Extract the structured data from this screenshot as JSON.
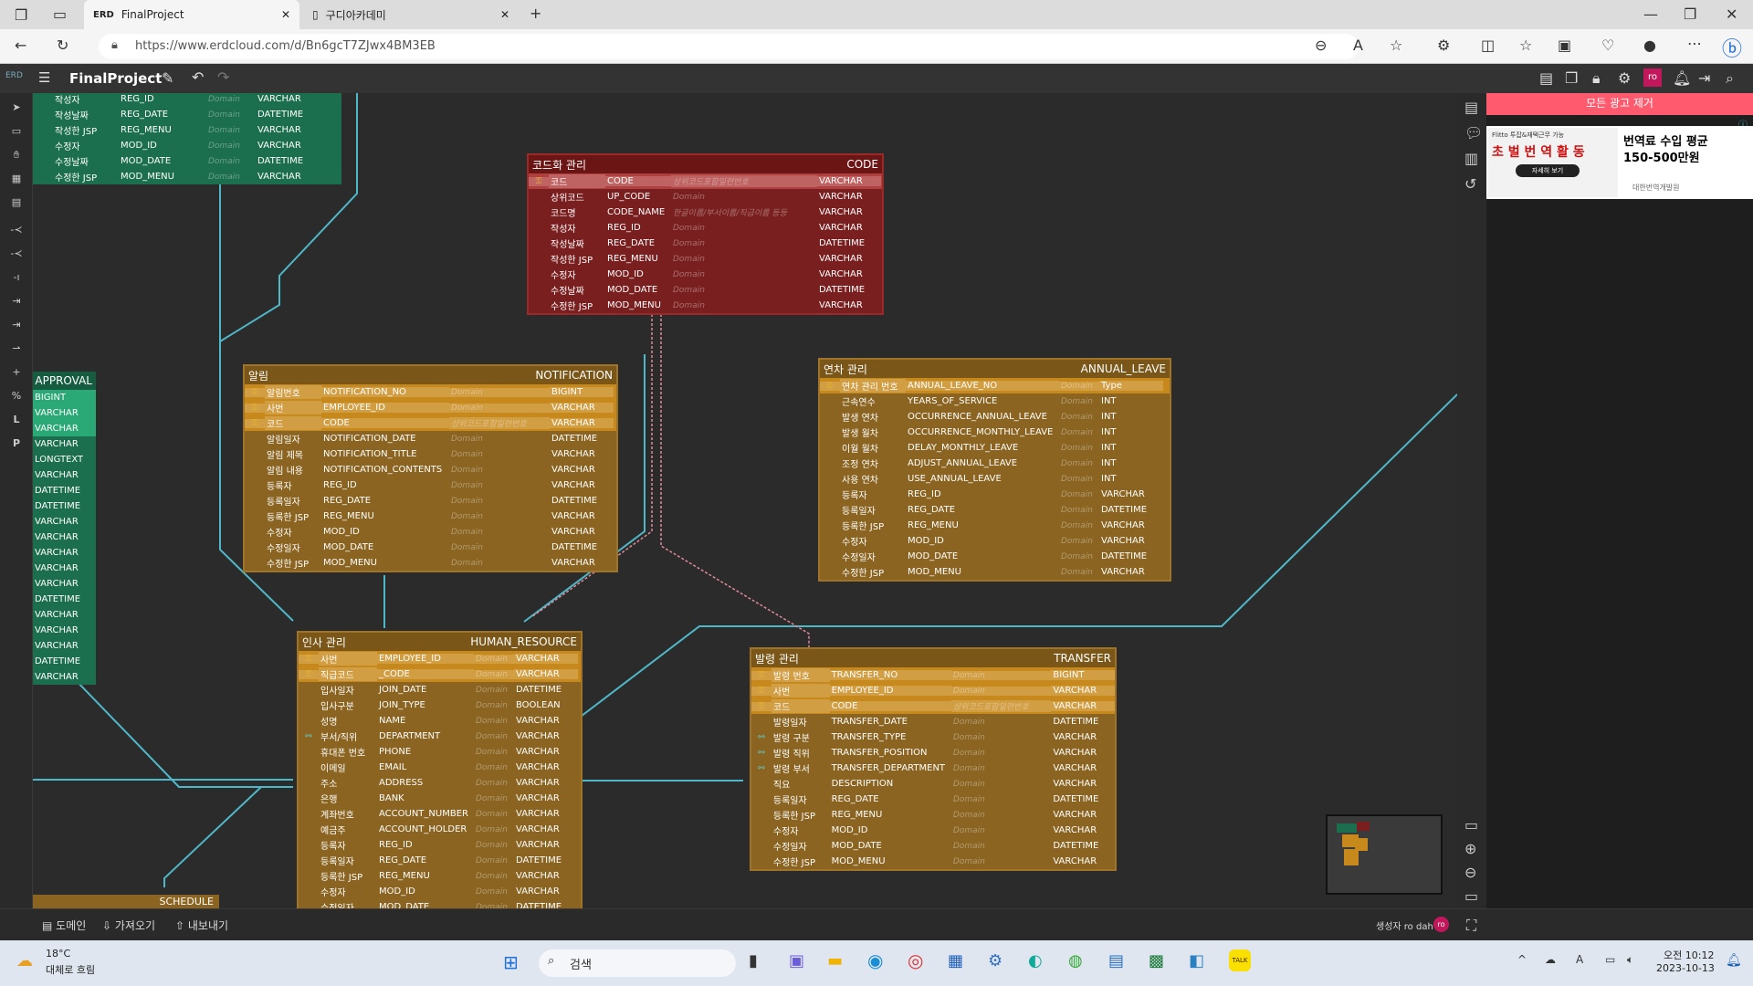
{
  "browser": {
    "tab1": "FinalProject",
    "tab2": "구디아카데미",
    "url": "https://www.erdcloud.com/d/Bn6gcT7ZJwx4BM3EB"
  },
  "app": {
    "title": "FinalProject",
    "avatar": "ro"
  },
  "ad": {
    "remove": "모든 광고 제거",
    "headline1": "번역료 수입 평균",
    "headline2": "150-500만원",
    "brand": "Flitto 투잡&재택근무 가능",
    "big": "초 벌 번 역 활 동",
    "btn": "자세히 보기",
    "sponsor": "대한번역개발원",
    "ad_mark": "ⓘ"
  },
  "bottom": {
    "domain": "도메인",
    "import": "가져오기",
    "export": "내보내기",
    "creator": "생성자 ro dah",
    "avatar": "ro"
  },
  "taskbar": {
    "temp": "18°C",
    "weather": "대체로 흐림",
    "search": "검색",
    "time": "오전 10:12",
    "date": "2023-10-13"
  },
  "tables": {
    "top_partial": {
      "rows": [
        [
          "작성자",
          "REG_ID",
          "Domain",
          "VARCHAR"
        ],
        [
          "작성날짜",
          "REG_DATE",
          "Domain",
          "DATETIME"
        ],
        [
          "작성한 JSP",
          "REG_MENU",
          "Domain",
          "VARCHAR"
        ],
        [
          "수정자",
          "MOD_ID",
          "Domain",
          "VARCHAR"
        ],
        [
          "수정날짜",
          "MOD_DATE",
          "Domain",
          "DATETIME"
        ],
        [
          "수정한 JSP",
          "MOD_MENU",
          "Domain",
          "VARCHAR"
        ]
      ]
    },
    "code": {
      "kname": "코드화 관리",
      "ename": "CODE",
      "rows": [
        [
          "코드",
          "CODE",
          "상위코드포함일련번호",
          "VARCHAR"
        ],
        [
          "상위코드",
          "UP_CODE",
          "Domain",
          "VARCHAR"
        ],
        [
          "코드명",
          "CODE_NAME",
          "한글이름/부서이름/직급이름 등등",
          "VARCHAR"
        ],
        [
          "작성자",
          "REG_ID",
          "Domain",
          "VARCHAR"
        ],
        [
          "작성날짜",
          "REG_DATE",
          "Domain",
          "DATETIME"
        ],
        [
          "작성한 JSP",
          "REG_MENU",
          "Domain",
          "VARCHAR"
        ],
        [
          "수정자",
          "MOD_ID",
          "Domain",
          "VARCHAR"
        ],
        [
          "수정날짜",
          "MOD_DATE",
          "Domain",
          "DATETIME"
        ],
        [
          "수정한 JSP",
          "MOD_MENU",
          "Domain",
          "VARCHAR"
        ]
      ]
    },
    "approval": {
      "ename": "APPROVAL",
      "rows": [
        "BIGINT",
        "VARCHAR",
        "VARCHAR",
        "VARCHAR",
        "LONGTEXT",
        "VARCHAR",
        "DATETIME",
        "DATETIME",
        "VARCHAR",
        "VARCHAR",
        "VARCHAR",
        "VARCHAR",
        "VARCHAR",
        "DATETIME",
        "VARCHAR",
        "VARCHAR",
        "VARCHAR",
        "DATETIME",
        "VARCHAR"
      ]
    },
    "notification": {
      "kname": "알림",
      "ename": "NOTIFICATION",
      "rows": [
        [
          "알림번호",
          "NOTIFICATION_NO",
          "Domain",
          "BIGINT"
        ],
        [
          "사번",
          "EMPLOYEE_ID",
          "Domain",
          "VARCHAR"
        ],
        [
          "코드",
          "CODE",
          "상위코드포함일련번호",
          "VARCHAR"
        ],
        [
          "알림일자",
          "NOTIFICATION_DATE",
          "Domain",
          "DATETIME"
        ],
        [
          "알림 제목",
          "NOTIFICATION_TITLE",
          "Domain",
          "VARCHAR"
        ],
        [
          "알림 내용",
          "NOTIFICATION_CONTENTS",
          "Domain",
          "VARCHAR"
        ],
        [
          "등록자",
          "REG_ID",
          "Domain",
          "VARCHAR"
        ],
        [
          "등록일자",
          "REG_DATE",
          "Domain",
          "DATETIME"
        ],
        [
          "등록한 JSP",
          "REG_MENU",
          "Domain",
          "VARCHAR"
        ],
        [
          "수정자",
          "MOD_ID",
          "Domain",
          "VARCHAR"
        ],
        [
          "수정일자",
          "MOD_DATE",
          "Domain",
          "DATETIME"
        ],
        [
          "수정한 JSP",
          "MOD_MENU",
          "Domain",
          "VARCHAR"
        ]
      ]
    },
    "annual": {
      "kname": "연차 관리",
      "ename": "ANNUAL_LEAVE",
      "rows": [
        [
          "연차 관리 번호",
          "ANNUAL_LEAVE_NO",
          "Domain",
          "Type"
        ],
        [
          "근속연수",
          "YEARS_OF_SERVICE",
          "Domain",
          "INT"
        ],
        [
          "발생 연차",
          "OCCURRENCE_ANNUAL_LEAVE",
          "Domain",
          "INT"
        ],
        [
          "발생 월차",
          "OCCURRENCE_MONTHLY_LEAVE",
          "Domain",
          "INT"
        ],
        [
          "이월 월차",
          "DELAY_MONTHLY_LEAVE",
          "Domain",
          "INT"
        ],
        [
          "조정 연차",
          "ADJUST_ANNUAL_LEAVE",
          "Domain",
          "INT"
        ],
        [
          "사용 연차",
          "USE_ANNUAL_LEAVE",
          "Domain",
          "INT"
        ],
        [
          "등록자",
          "REG_ID",
          "Domain",
          "VARCHAR"
        ],
        [
          "등록일자",
          "REG_DATE",
          "Domain",
          "DATETIME"
        ],
        [
          "등록한 JSP",
          "REG_MENU",
          "Domain",
          "VARCHAR"
        ],
        [
          "수정자",
          "MOD_ID",
          "Domain",
          "VARCHAR"
        ],
        [
          "수정일자",
          "MOD_DATE",
          "Domain",
          "DATETIME"
        ],
        [
          "수정한 JSP",
          "MOD_MENU",
          "Domain",
          "VARCHAR"
        ]
      ]
    },
    "hr": {
      "kname": "인사 관리",
      "ename": "HUMAN_RESOURCE",
      "rows": [
        [
          "사번",
          "EMPLOYEE_ID",
          "Domain",
          "VARCHAR"
        ],
        [
          "직급코드",
          "_CODE",
          "Domain",
          "VARCHAR"
        ],
        [
          "입사일자",
          "JOIN_DATE",
          "Domain",
          "DATETIME"
        ],
        [
          "입사구분",
          "JOIN_TYPE",
          "Domain",
          "BOOLEAN"
        ],
        [
          "성명",
          "NAME",
          "Domain",
          "VARCHAR"
        ],
        [
          "부서/직위",
          "DEPARTMENT",
          "Domain",
          "VARCHAR"
        ],
        [
          "휴대폰 번호",
          "PHONE",
          "Domain",
          "VARCHAR"
        ],
        [
          "이메일",
          "EMAIL",
          "Domain",
          "VARCHAR"
        ],
        [
          "주소",
          "ADDRESS",
          "Domain",
          "VARCHAR"
        ],
        [
          "은행",
          "BANK",
          "Domain",
          "VARCHAR"
        ],
        [
          "계좌번호",
          "ACCOUNT_NUMBER",
          "Domain",
          "VARCHAR"
        ],
        [
          "예금주",
          "ACCOUNT_HOLDER",
          "Domain",
          "VARCHAR"
        ],
        [
          "등록자",
          "REG_ID",
          "Domain",
          "VARCHAR"
        ],
        [
          "등록일자",
          "REG_DATE",
          "Domain",
          "DATETIME"
        ],
        [
          "등록한 JSP",
          "REG_MENU",
          "Domain",
          "VARCHAR"
        ],
        [
          "수정자",
          "MOD_ID",
          "Domain",
          "VARCHAR"
        ],
        [
          "수정일자",
          "MOD_DATE",
          "Domain",
          "DATETIME"
        ]
      ]
    },
    "transfer": {
      "kname": "발령 관리",
      "ename": "TRANSFER",
      "rows": [
        [
          "발령 번호",
          "TRANSFER_NO",
          "Domain",
          "BIGINT"
        ],
        [
          "사번",
          "EMPLOYEE_ID",
          "Domain",
          "VARCHAR"
        ],
        [
          "코드",
          "CODE",
          "상위코드포함일련번호",
          "VARCHAR"
        ],
        [
          "발령일자",
          "TRANSFER_DATE",
          "Domain",
          "DATETIME"
        ],
        [
          "발령 구분",
          "TRANSFER_TYPE",
          "Domain",
          "VARCHAR"
        ],
        [
          "발령 직위",
          "TRANSFER_POSITION",
          "Domain",
          "VARCHAR"
        ],
        [
          "발령 부서",
          "TRANSFER_DEPARTMENT",
          "Domain",
          "VARCHAR"
        ],
        [
          "직요",
          "DESCRIPTION",
          "Domain",
          "VARCHAR"
        ],
        [
          "등록일자",
          "REG_DATE",
          "Domain",
          "DATETIME"
        ],
        [
          "등록한 JSP",
          "REG_MENU",
          "Domain",
          "VARCHAR"
        ],
        [
          "수정자",
          "MOD_ID",
          "Domain",
          "VARCHAR"
        ],
        [
          "수정일자",
          "MOD_DATE",
          "Domain",
          "DATETIME"
        ],
        [
          "수정한 JSP",
          "MOD_MENU",
          "Domain",
          "VARCHAR"
        ]
      ]
    },
    "schedule": {
      "ename": "SCHEDULE"
    }
  },
  "colors": {
    "code": "#7a1f1f",
    "code_head": "#6b1515",
    "gold": "#8a6420",
    "gold_head": "#7a5618",
    "green": "#1b6e4e",
    "line": "#4fb8c8"
  },
  "left_tools": [
    "L",
    "P"
  ]
}
